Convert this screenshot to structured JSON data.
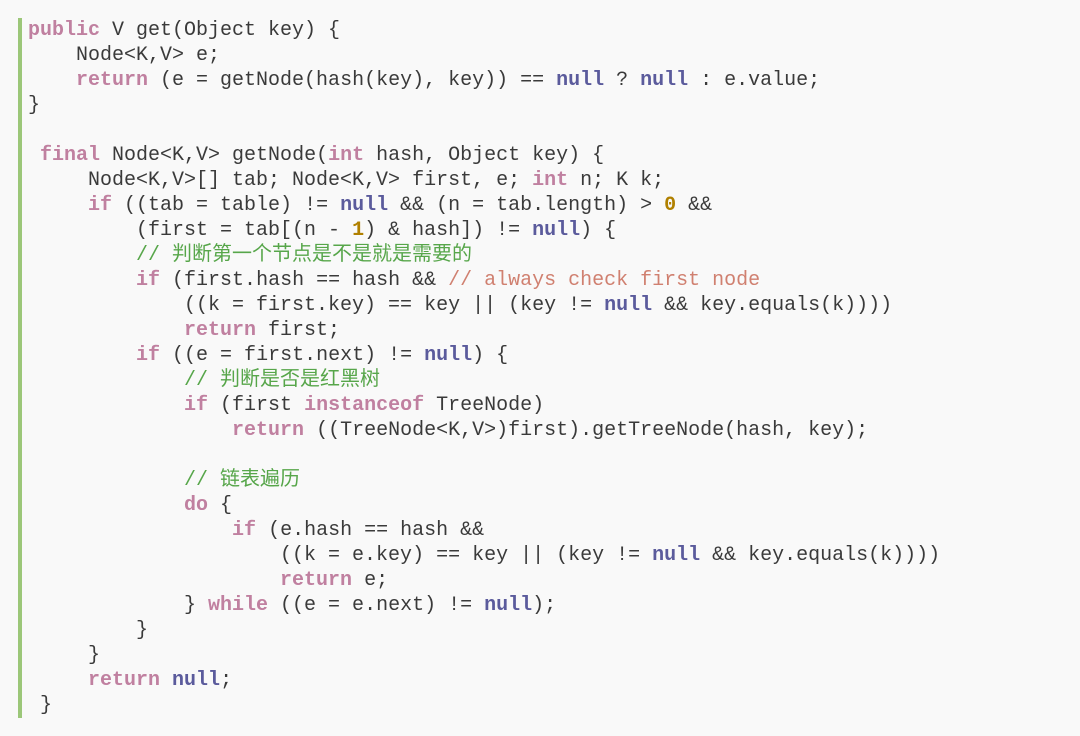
{
  "code": {
    "lines": [
      [
        [
          "kw",
          "public"
        ],
        [
          "plain",
          " V get(Object key) {"
        ]
      ],
      [
        [
          "plain",
          "    Node<K,V> e;"
        ]
      ],
      [
        [
          "plain",
          "    "
        ],
        [
          "kw",
          "return"
        ],
        [
          "plain",
          " (e = getNode(hash(key), key)) == "
        ],
        [
          "nl",
          "null"
        ],
        [
          "plain",
          " ? "
        ],
        [
          "nl",
          "null"
        ],
        [
          "plain",
          " : e.value;"
        ]
      ],
      [
        [
          "plain",
          "}"
        ]
      ],
      [
        [
          "plain",
          ""
        ]
      ],
      [
        [
          "plain",
          " "
        ],
        [
          "kw",
          "final"
        ],
        [
          "plain",
          " Node<K,V> getNode("
        ],
        [
          "kw",
          "int"
        ],
        [
          "plain",
          " hash, Object key) {"
        ]
      ],
      [
        [
          "plain",
          "     Node<K,V>[] tab; Node<K,V> first, e; "
        ],
        [
          "kw",
          "int"
        ],
        [
          "plain",
          " n; K k;"
        ]
      ],
      [
        [
          "plain",
          "     "
        ],
        [
          "kw",
          "if"
        ],
        [
          "plain",
          " ((tab = table) != "
        ],
        [
          "nl",
          "null"
        ],
        [
          "plain",
          " && (n = tab.length) > "
        ],
        [
          "num",
          "0"
        ],
        [
          "plain",
          " &&"
        ]
      ],
      [
        [
          "plain",
          "         (first = tab[(n - "
        ],
        [
          "num",
          "1"
        ],
        [
          "plain",
          ") & hash]) != "
        ],
        [
          "nl",
          "null"
        ],
        [
          "plain",
          ") {"
        ]
      ],
      [
        [
          "plain",
          "         "
        ],
        [
          "cmt",
          "// 判断第一个节点是不是就是需要的"
        ]
      ],
      [
        [
          "plain",
          "         "
        ],
        [
          "kw",
          "if"
        ],
        [
          "plain",
          " (first.hash == hash && "
        ],
        [
          "scmt",
          "// always check first node"
        ]
      ],
      [
        [
          "plain",
          "             ((k = first.key) == key || (key != "
        ],
        [
          "nl",
          "null"
        ],
        [
          "plain",
          " && key.equals(k))))"
        ]
      ],
      [
        [
          "plain",
          "             "
        ],
        [
          "kw",
          "return"
        ],
        [
          "plain",
          " first;"
        ]
      ],
      [
        [
          "plain",
          "         "
        ],
        [
          "kw",
          "if"
        ],
        [
          "plain",
          " ((e = first.next) != "
        ],
        [
          "nl",
          "null"
        ],
        [
          "plain",
          ") {"
        ]
      ],
      [
        [
          "plain",
          "             "
        ],
        [
          "cmt",
          "// 判断是否是红黑树"
        ]
      ],
      [
        [
          "plain",
          "             "
        ],
        [
          "kw",
          "if"
        ],
        [
          "plain",
          " (first "
        ],
        [
          "kw",
          "instanceof"
        ],
        [
          "plain",
          " TreeNode)"
        ]
      ],
      [
        [
          "plain",
          "                 "
        ],
        [
          "kw",
          "return"
        ],
        [
          "plain",
          " ((TreeNode<K,V>)first).getTreeNode(hash, key);"
        ]
      ],
      [
        [
          "plain",
          ""
        ]
      ],
      [
        [
          "plain",
          "             "
        ],
        [
          "cmt",
          "// 链表遍历"
        ]
      ],
      [
        [
          "plain",
          "             "
        ],
        [
          "kw",
          "do"
        ],
        [
          "plain",
          " {"
        ]
      ],
      [
        [
          "plain",
          "                 "
        ],
        [
          "kw",
          "if"
        ],
        [
          "plain",
          " (e.hash == hash &&"
        ]
      ],
      [
        [
          "plain",
          "                     ((k = e.key) == key || (key != "
        ],
        [
          "nl",
          "null"
        ],
        [
          "plain",
          " && key.equals(k))))"
        ]
      ],
      [
        [
          "plain",
          "                     "
        ],
        [
          "kw",
          "return"
        ],
        [
          "plain",
          " e;"
        ]
      ],
      [
        [
          "plain",
          "             } "
        ],
        [
          "kw",
          "while"
        ],
        [
          "plain",
          " ((e = e.next) != "
        ],
        [
          "nl",
          "null"
        ],
        [
          "plain",
          ");"
        ]
      ],
      [
        [
          "plain",
          "         }"
        ]
      ],
      [
        [
          "plain",
          "     }"
        ]
      ],
      [
        [
          "plain",
          "     "
        ],
        [
          "kw",
          "return"
        ],
        [
          "plain",
          " "
        ],
        [
          "nl",
          "null"
        ],
        [
          "plain",
          ";"
        ]
      ],
      [
        [
          "plain",
          " }"
        ]
      ]
    ]
  }
}
